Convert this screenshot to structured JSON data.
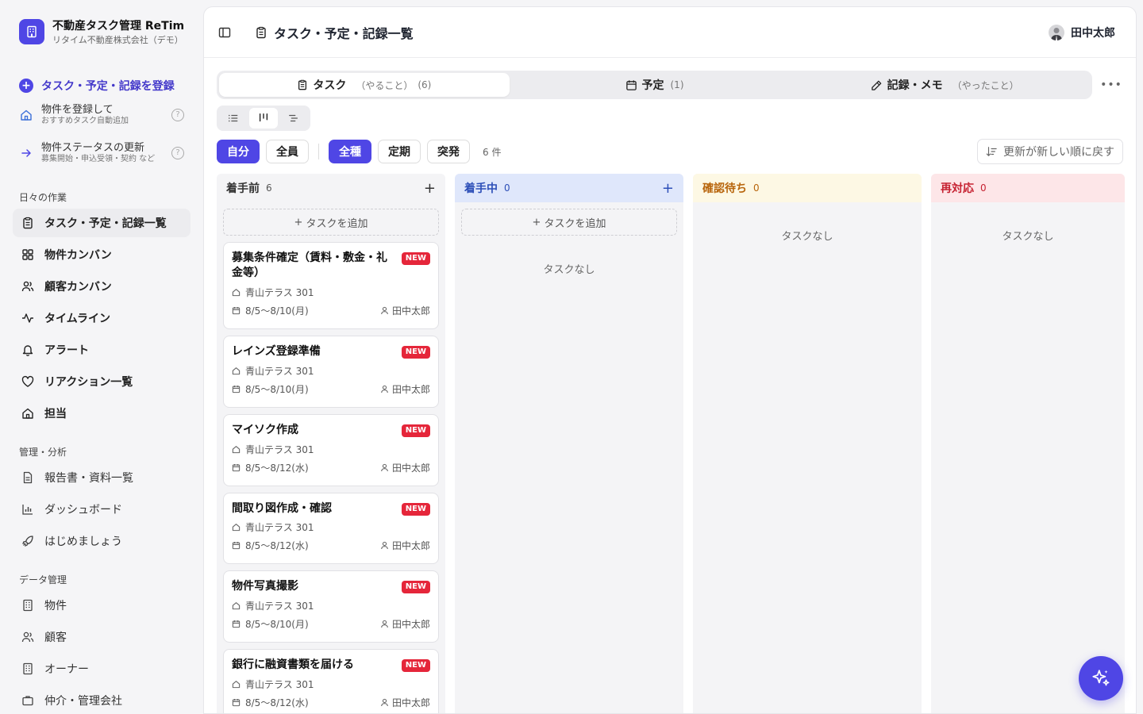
{
  "brand": {
    "title": "不動産タスク管理 ReTime",
    "subtitle": "リタイム不動産株式会社（デモ）",
    "accent": "#4f46e5"
  },
  "sidebar": {
    "register_label": "タスク・予定・記録を登録",
    "sub_actions": [
      {
        "title": "物件を登録して",
        "subtitle": "おすすめタスク自動追加",
        "icon": "home-icon"
      },
      {
        "title": "物件ステータスの更新",
        "subtitle": "募集開始・申込受領・契約 など",
        "icon": "arrow-right-icon"
      }
    ],
    "sections": [
      {
        "title": "日々の作業",
        "items": [
          {
            "label": "タスク・予定・記録一覧",
            "icon": "clipboard-icon"
          },
          {
            "label": "物件カンバン",
            "icon": "grid-icon"
          },
          {
            "label": "顧客カンバン",
            "icon": "users-icon"
          },
          {
            "label": "タイムライン",
            "icon": "activity-icon"
          },
          {
            "label": "アラート",
            "icon": "bell-icon"
          },
          {
            "label": "リアクション一覧",
            "icon": "heart-icon"
          },
          {
            "label": "担当",
            "icon": "home-icon"
          }
        ]
      },
      {
        "title": "管理・分析",
        "items": [
          {
            "label": "報告書・資料一覧",
            "icon": "document-icon"
          },
          {
            "label": "ダッシュボード",
            "icon": "bar-chart-icon"
          },
          {
            "label": "はじめましょう",
            "icon": "rocket-icon"
          }
        ]
      },
      {
        "title": "データ管理",
        "items": [
          {
            "label": "物件",
            "icon": "building-icon"
          },
          {
            "label": "顧客",
            "icon": "users-icon"
          },
          {
            "label": "オーナー",
            "icon": "building-icon"
          },
          {
            "label": "仲介・管理会社",
            "icon": "briefcase-icon"
          }
        ]
      }
    ]
  },
  "header": {
    "title": "タスク・予定・記録一覧",
    "user": "田中太郎"
  },
  "tabs": [
    {
      "label": "タスク",
      "sub": "（やること）",
      "count": "(6)",
      "icon": "clipboard-icon"
    },
    {
      "label": "予定",
      "sub": "",
      "count": "(1)",
      "icon": "calendar-icon"
    },
    {
      "label": "記録・メモ",
      "sub": "（やったこと）",
      "count": "",
      "icon": "pencil-icon"
    }
  ],
  "filters": {
    "scope": [
      "自分",
      "全員"
    ],
    "types": [
      "全種",
      "定期",
      "突発"
    ],
    "count_text": "6 件",
    "sort_label": "更新が新しい順に戻す"
  },
  "columns": [
    {
      "title": "着手前",
      "count": "6",
      "add_label": "タスクを追加",
      "color": "#333333"
    },
    {
      "title": "着手中",
      "count": "0",
      "add_label": "タスクを追加",
      "empty": "タスクなし",
      "color": "#2d4fb8"
    },
    {
      "title": "確認待ち",
      "count": "0",
      "empty": "タスクなし",
      "color": "#b8650c"
    },
    {
      "title": "再対応",
      "count": "0",
      "empty": "タスクなし",
      "color": "#c62232"
    }
  ],
  "cards": [
    {
      "title": "募集条件確定（賃料・敷金・礼金等）",
      "badge": "NEW",
      "property": "青山テラス 301",
      "date": "8/5〜8/10(月)",
      "assignee": "田中太郎"
    },
    {
      "title": "レインズ登録準備",
      "badge": "NEW",
      "property": "青山テラス 301",
      "date": "8/5〜8/10(月)",
      "assignee": "田中太郎"
    },
    {
      "title": "マイソク作成",
      "badge": "NEW",
      "property": "青山テラス 301",
      "date": "8/5〜8/12(水)",
      "assignee": "田中太郎"
    },
    {
      "title": "間取り図作成・確認",
      "badge": "NEW",
      "property": "青山テラス 301",
      "date": "8/5〜8/12(水)",
      "assignee": "田中太郎"
    },
    {
      "title": "物件写真撮影",
      "badge": "NEW",
      "property": "青山テラス 301",
      "date": "8/5〜8/10(月)",
      "assignee": "田中太郎"
    },
    {
      "title": "銀行に融資書類を届ける",
      "badge": "NEW",
      "property": "青山テラス 301",
      "date": "8/5〜8/12(水)",
      "assignee": "田中太郎"
    }
  ]
}
